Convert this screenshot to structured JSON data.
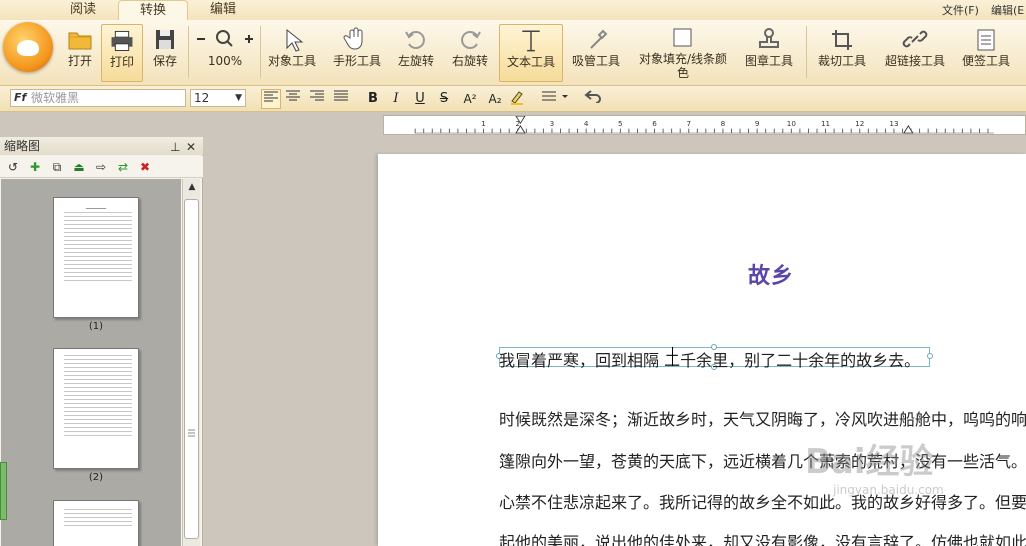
{
  "menu_tabs": [
    "阅读",
    "转换",
    "编辑"
  ],
  "menu_right": [
    "文件(F)",
    "编辑(E"
  ],
  "ribbon": {
    "open": "打开",
    "print": "打印",
    "save": "保存",
    "zoom": "100%",
    "object_tool": "对象工具",
    "hand_tool": "手形工具",
    "rotate_left": "左旋转",
    "rotate_right": "右旋转",
    "text_tool": "文本工具",
    "eyedropper_tool": "吸管工具",
    "fill_line_color_1": "对象填充/线条颜",
    "fill_line_color_2": "色",
    "stamp_tool": "图章工具",
    "crop_tool": "裁切工具",
    "hyperlink_tool": "超链接工具",
    "note_tool": "便签工具"
  },
  "format": {
    "font_placeholder": "微软雅黑",
    "font_size": "12",
    "font_prefix": "Ff",
    "bold": "B",
    "italic": "I",
    "underline": "U",
    "strike": "S",
    "superscript": "A²",
    "subscript": "A₂"
  },
  "ruler": {
    "ticks": [
      "1",
      "2",
      "3",
      "4",
      "5",
      "6",
      "7",
      "8",
      "9",
      "10",
      "11",
      "12",
      "13"
    ]
  },
  "thumb_panel": {
    "title": "缩略图",
    "pages": [
      "(1)",
      "(2)"
    ]
  },
  "document": {
    "title": "故乡",
    "selected_line": "我冒着严寒，回到相隔 二千余里，别了二十余年的故乡去。",
    "lines": [
      "时候既然是深冬；渐近故乡时，天气又阴晦了，冷风吹进船舱中，呜呜的响",
      "篷隙向外一望，苍黄的天底下，远近横着几个萧索的荒村，没有一些活气。我",
      "心禁不住悲凉起来了。我所记得的故乡全不如此。我的故乡好得多了。但要我",
      "起他的美丽，说出他的佳处来，却又没有影像，没有言辞了。仿佛也就如此。"
    ]
  },
  "watermark": {
    "brand": "Bai经验",
    "url": "jingyan.baidu.com"
  }
}
